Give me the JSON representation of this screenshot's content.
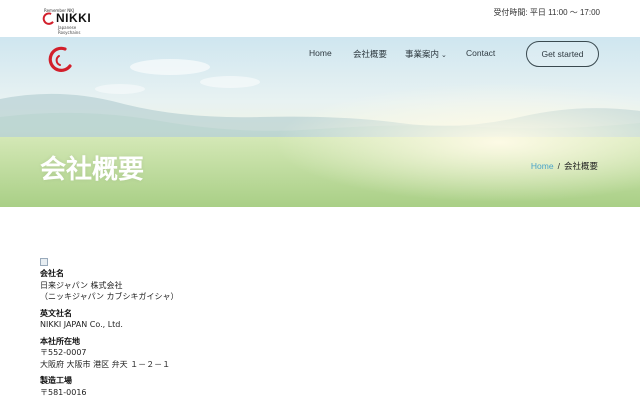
{
  "topbar": {
    "logo_tiny": "Remember NKJ",
    "logo_name": "NIKKI",
    "logo_sub": "Japanese Rosychains",
    "hours": "受付時間: 平日 11:00 ～ 17:00"
  },
  "nav": {
    "home": "Home",
    "about": "会社概要",
    "business": "事業案内",
    "contact": "Contact",
    "cta": "Get started"
  },
  "hero": {
    "title": "会社概要",
    "breadcrumb_home": "Home",
    "breadcrumb_sep": "/",
    "breadcrumb_current": "会社概要"
  },
  "company": {
    "name_label": "会社名",
    "name_value": "日来ジャパン 株式会社",
    "name_kana": "（ニッキジャパン カブシキガイシャ）",
    "en_label": "英文社名",
    "en_value": "NIKKI JAPAN Co., Ltd.",
    "hq_label": "本社所在地",
    "hq_zip": "〒552-0007",
    "hq_addr": "大阪府 大阪市 港区 弁天 １－２－１",
    "factory_label": "製造工場",
    "factory_zip": "〒581-0016"
  },
  "colors": {
    "accent": "#4aa3c8",
    "brand_red": "#d21f2b"
  }
}
